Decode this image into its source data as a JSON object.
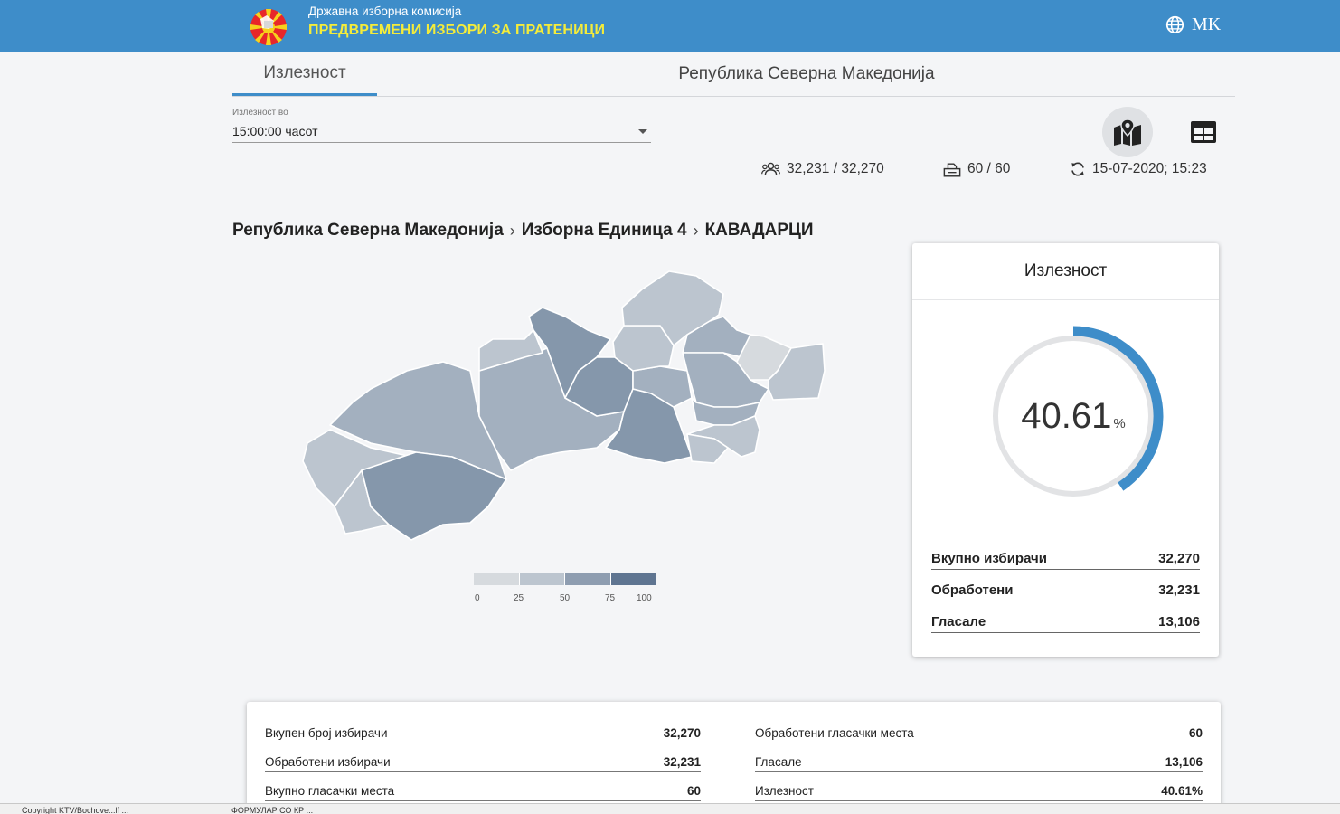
{
  "header": {
    "org_name": "Државна изборна комисија",
    "election_name": "ПРЕДВРЕМЕНИ ИЗБОРИ ЗА ПРАТЕНИЦИ",
    "language": "MK",
    "language_icon": "globe-icon",
    "logo_icon": "sec-emblem-icon",
    "bar_color": "#3e8dc9"
  },
  "tabs": [
    {
      "label": "Излезност",
      "active": true
    },
    {
      "label": "Република Северна Македонија",
      "active": false
    }
  ],
  "turnout_select": {
    "label": "Излезност во",
    "value": "15:00:00 часот"
  },
  "view_buttons": {
    "map_icon": "map-marker-icon",
    "table_icon": "table-icon"
  },
  "stats": {
    "voters": "32,231 / 32,270",
    "voters_icon": "people-icon",
    "stations": "60 / 60",
    "stations_icon": "ballot-box-icon",
    "updated": "15-07-2020; 15:23",
    "updated_icon": "refresh-icon"
  },
  "breadcrumb": [
    "Република Северна Македонија",
    "Изборна Единица 4",
    "КАВАДАРЦИ"
  ],
  "legend": {
    "ticks": [
      "0",
      "25",
      "50",
      "75",
      "100"
    ],
    "colors": [
      "#d6dade",
      "#bcc5cf",
      "#a3b0bf",
      "#8597ab",
      "#5f7591"
    ]
  },
  "turnout_card": {
    "title": "Излезност",
    "value": "40.61",
    "unit": "%",
    "percent": 40.61,
    "arc_color": "#3e8dc9",
    "rows": [
      {
        "label": "Вкупно избирачи",
        "value": "32,270"
      },
      {
        "label": "Обработени",
        "value": "32,231"
      },
      {
        "label": "Гласале",
        "value": "13,106"
      }
    ]
  },
  "summary": {
    "left": [
      {
        "label": "Вкупен број избирачи",
        "value": "32,270"
      },
      {
        "label": "Обработени избирачи",
        "value": "32,231"
      },
      {
        "label": "Вкупно гласачки места",
        "value": "60"
      }
    ],
    "right": [
      {
        "label": "Обработени гласачки места",
        "value": "60"
      },
      {
        "label": "Гласале",
        "value": "13,106"
      },
      {
        "label": "Излезност",
        "value": "40.61%"
      }
    ]
  },
  "statusbar": {
    "left": "Copyright KTV/Bochove...lf ...",
    "middle": "ФОРМУЛАР СО КР ..."
  }
}
